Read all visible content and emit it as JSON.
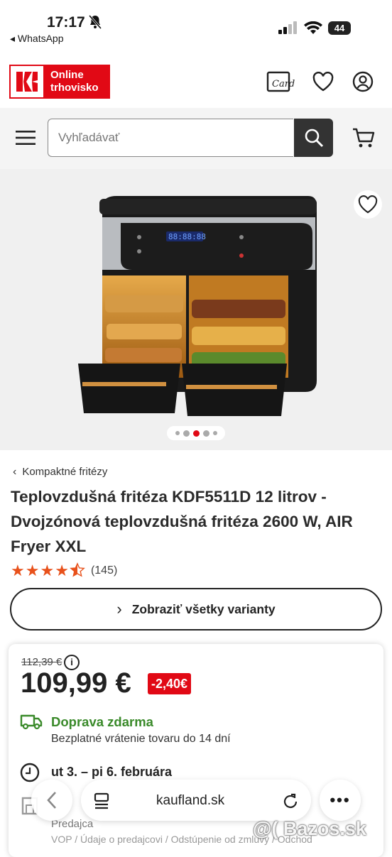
{
  "status": {
    "time": "17:17",
    "back_app": "◂ WhatsApp",
    "battery": "44"
  },
  "header": {
    "logo_text_line1": "Online",
    "logo_text_line2": "trhovisko",
    "card_label": "Card"
  },
  "search": {
    "placeholder": "Vyhľadávať"
  },
  "breadcrumb": {
    "label": "Kompaktné fritézy"
  },
  "product": {
    "title": "Teplovzdušná fritéza KDF5511D 12 litrov - Dvojzónová teplovzdušná fritéza 2600 W, AIR Fryer XXL",
    "rating": 4.5,
    "rating_count": "(145)",
    "variants_button": "Zobraziť všetky varianty",
    "old_price": "112,39 €",
    "price": "109,99 €",
    "discount": "-2,40€",
    "shipping_title": "Doprava zdarma",
    "shipping_sub": "Bezplatné vrátenie tovaru do 14 dní",
    "delivery": "ut 3. – pi 6. februára",
    "seller_label": "Predajca",
    "seller_links": "VOP / Údaje o predajcovi / Odstúpenie od zmluvy / Odchod"
  },
  "gallery": {
    "dots": 5,
    "active_dot": 2
  },
  "browser": {
    "url": "kaufland.sk"
  },
  "watermark": "@( Bazos.sk",
  "colors": {
    "brand_red": "#e10915",
    "shipping_green": "#3a8a2a",
    "star_orange": "#e8511b"
  }
}
